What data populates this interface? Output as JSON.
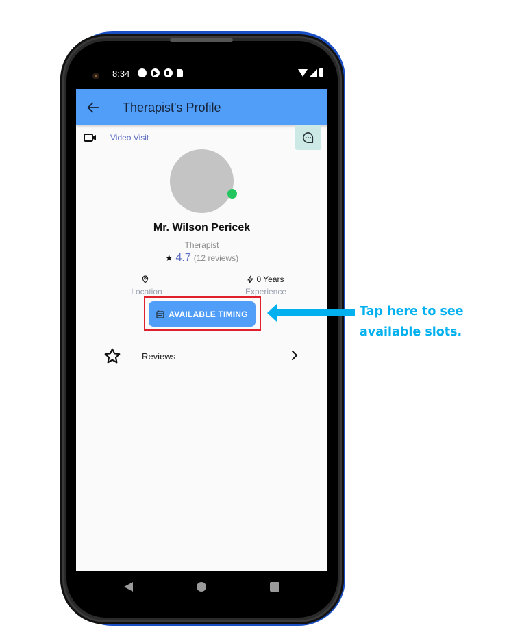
{
  "status_bar": {
    "time": "8:34"
  },
  "app_bar": {
    "title": "Therapist's Profile"
  },
  "visit": {
    "label": "Video Visit"
  },
  "profile": {
    "name": "Mr. Wilson Pericek",
    "role": "Therapist",
    "rating": "4.7",
    "reviews_count": "(12 reviews)",
    "online": true,
    "online_color": "#22c55e"
  },
  "info": {
    "location_value": "",
    "location_label": "Location",
    "experience_value": "0 Years",
    "experience_label": "Experience"
  },
  "actions": {
    "available_timing": "AVAILABLE TIMING"
  },
  "menu": {
    "reviews_label": "Reviews"
  },
  "annotation": {
    "text": "Tap here to see available slots.",
    "color": "#00b0ef",
    "highlight_color": "#e0202a"
  },
  "theme": {
    "primary": "#519ef8",
    "accent_text": "#5b6bc0",
    "chat_bg": "#cce9e6"
  }
}
